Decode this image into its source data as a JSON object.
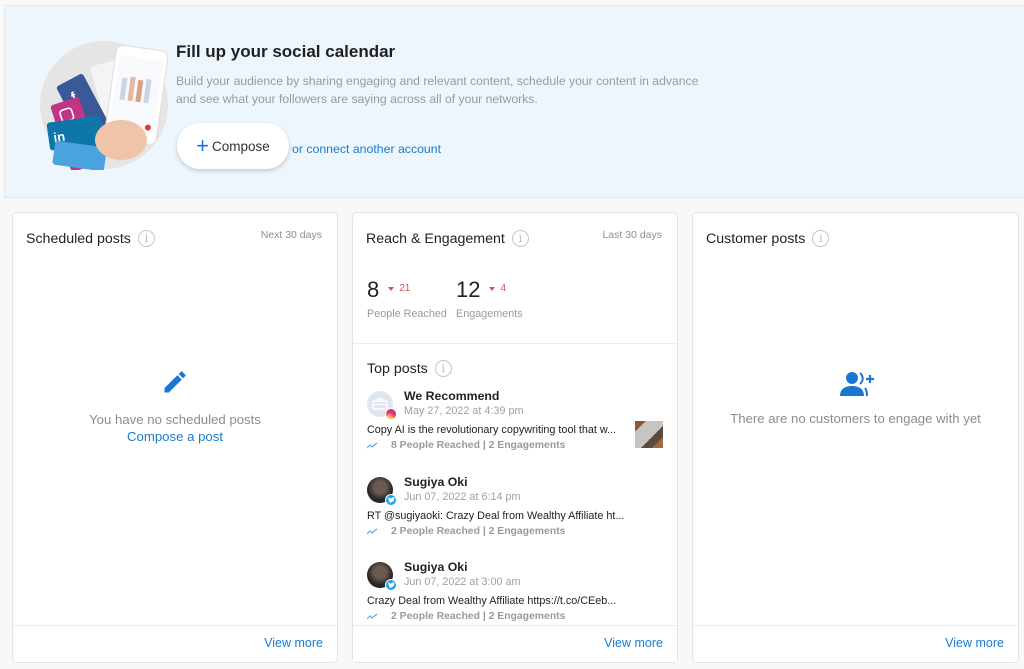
{
  "banner": {
    "title": "Fill up your social calendar",
    "description": "Build your audience by sharing engaging and relevant content, schedule your content in advance and see what your followers are saying across all of your networks.",
    "compose_label": "Compose",
    "connect_label": "or connect another account"
  },
  "scheduled": {
    "title": "Scheduled posts",
    "range": "Next 30 days",
    "empty_text": "You have no scheduled posts",
    "empty_link": "Compose a post",
    "view_more": "View more"
  },
  "reach": {
    "title": "Reach & Engagement",
    "range": "Last 30 days",
    "metrics": [
      {
        "value": "8",
        "delta": "21",
        "direction": "down",
        "label": "People Reached"
      },
      {
        "value": "12",
        "delta": "4",
        "direction": "down",
        "label": "Engagements"
      }
    ],
    "top_posts_title": "Top posts",
    "posts": [
      {
        "name": "We Recommend",
        "date": "May 27, 2022 at 4:39 pm",
        "network": "instagram",
        "text": "Copy AI is the revolutionary copywriting tool that w...",
        "stats": "8 People Reached | 2 Engagements",
        "has_thumbnail": true
      },
      {
        "name": "Sugiya Oki",
        "date": "Jun 07, 2022 at 6:14 pm",
        "network": "twitter",
        "text": "RT @sugiyaoki: Crazy Deal from Wealthy Affiliate ht...",
        "stats": "2 People Reached | 2 Engagements",
        "has_thumbnail": false
      },
      {
        "name": "Sugiya Oki",
        "date": "Jun 07, 2022 at 3:00 am",
        "network": "twitter",
        "text": "Crazy Deal from Wealthy Affiliate https://t.co/CEeb...",
        "stats": "2 People Reached | 2 Engagements",
        "has_thumbnail": false
      }
    ],
    "view_more": "View more"
  },
  "customers": {
    "title": "Customer posts",
    "empty_text": "There are no customers to engage with yet",
    "view_more": "View more"
  },
  "colors": {
    "accent": "#1a7bd1",
    "negative": "#d9534f",
    "banner_bg": "#eef6fd"
  }
}
